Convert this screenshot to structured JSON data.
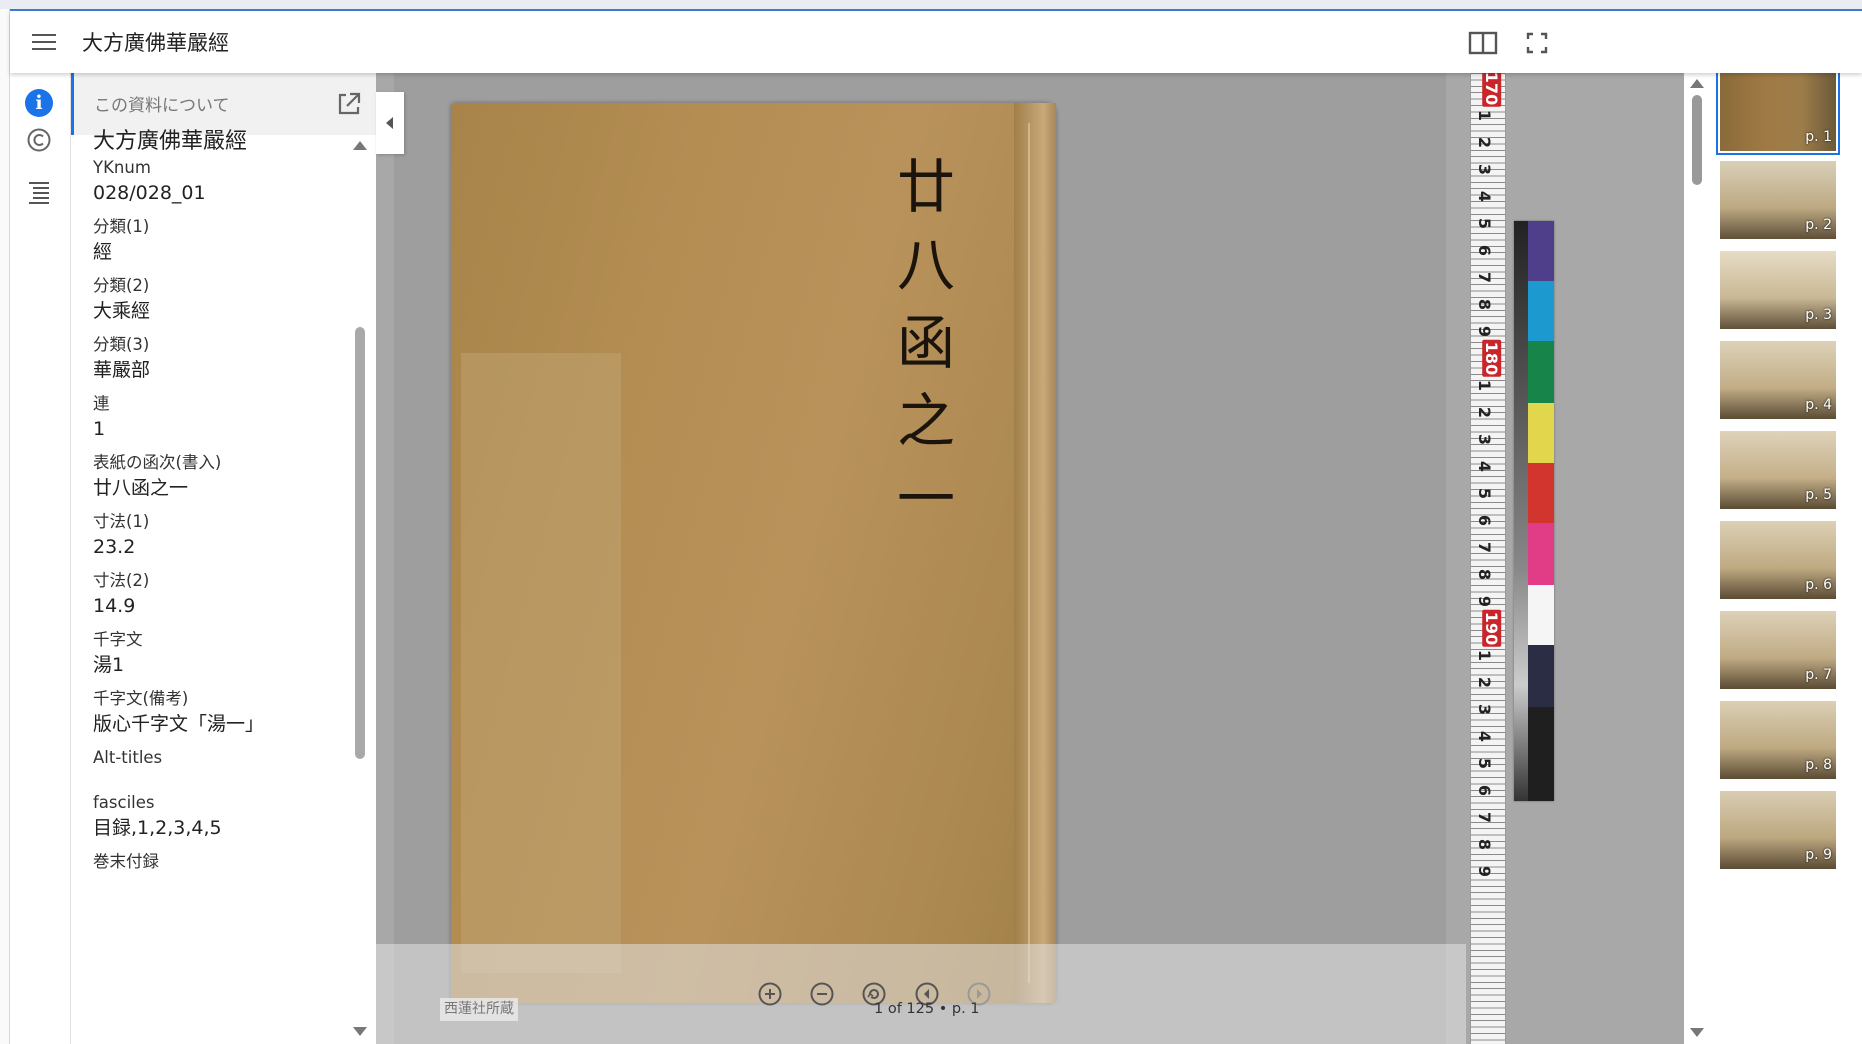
{
  "header": {
    "title": "大方廣佛華嚴經",
    "menu_icon": "hamburger-menu-icon",
    "book_view_icon": "book-view-icon",
    "fullscreen_icon": "fullscreen-icon"
  },
  "rail": {
    "items": [
      {
        "icon": "info-icon",
        "active": true
      },
      {
        "icon": "copyright-icon",
        "active": false
      },
      {
        "icon": "table-of-contents-icon",
        "active": false
      }
    ]
  },
  "panel": {
    "heading": "この資料について",
    "title": "大方廣佛華嚴經",
    "fields": [
      {
        "label": "YKnum",
        "value": "028/028_01"
      },
      {
        "label": "分類(1)",
        "value": "經"
      },
      {
        "label": "分類(2)",
        "value": "大乘經"
      },
      {
        "label": "分類(3)",
        "value": "華嚴部"
      },
      {
        "label": "連",
        "value": "1"
      },
      {
        "label": "表紙の函次(書入)",
        "value": "廿八函之一"
      },
      {
        "label": "寸法(1)",
        "value": "23.2"
      },
      {
        "label": "寸法(2)",
        "value": "14.9"
      },
      {
        "label": "千字文",
        "value": "湯1"
      },
      {
        "label": "千字文(備考)",
        "value": "版心千字文「湯一」"
      },
      {
        "label": "Alt-titles",
        "value": ""
      },
      {
        "label": "fasciles",
        "value": "目録,1,2,3,4,5"
      },
      {
        "label": "巻末付録",
        "value": ""
      }
    ]
  },
  "viewer": {
    "cover_inscription": "廿八函之一",
    "credit": "西蓮社所蔵",
    "page_indicator": "1 of 125 • p. 1",
    "ruler_labels": [
      "170",
      "1",
      "2",
      "3",
      "4",
      "5",
      "6",
      "7",
      "8",
      "9",
      "180",
      "1",
      "2",
      "3",
      "4",
      "5",
      "6",
      "7",
      "8",
      "9",
      "190",
      "1",
      "2",
      "3",
      "4",
      "5",
      "6",
      "7",
      "8",
      "9"
    ],
    "controls": [
      "zoom-in-icon",
      "zoom-out-icon",
      "reset-zoom-icon",
      "previous-page-icon",
      "next-page-icon"
    ]
  },
  "thumbnails": [
    {
      "label": "p. 1",
      "selected": true
    },
    {
      "label": "p. 2",
      "selected": false
    },
    {
      "label": "p. 3",
      "selected": false
    },
    {
      "label": "p. 4",
      "selected": false
    },
    {
      "label": "p. 5",
      "selected": false
    },
    {
      "label": "p. 6",
      "selected": false
    },
    {
      "label": "p. 7",
      "selected": false
    },
    {
      "label": "p. 8",
      "selected": false
    },
    {
      "label": "p. 9",
      "selected": false
    }
  ]
}
